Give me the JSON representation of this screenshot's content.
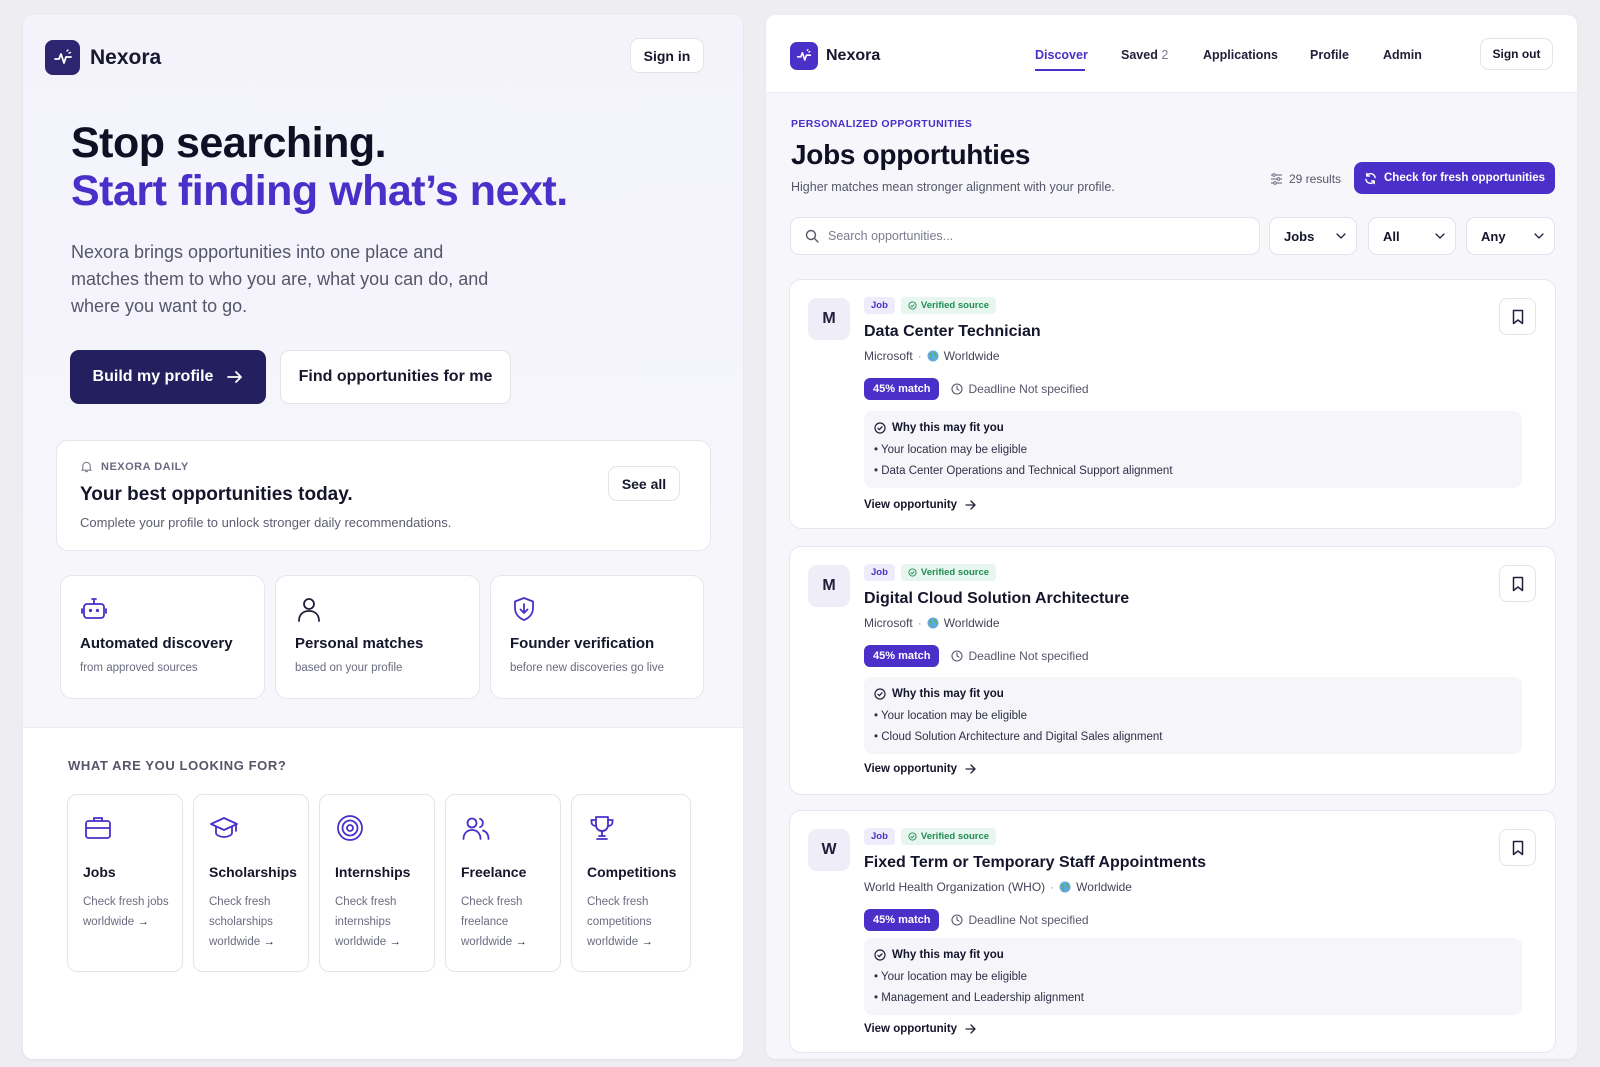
{
  "brand": {
    "name": "Nexora",
    "accent": "#4a2fc8",
    "dark": "#24205f"
  },
  "landing": {
    "sign_in": "Sign in",
    "headline_1": "Stop searching.",
    "headline_2": "Start finding what’s next.",
    "subtitle": "Nexora brings opportunities into one place and matches them to who you are, what you can do, and where you want to go.",
    "primary_cta": "Build my profile",
    "secondary_cta": "Find opportunities for me",
    "daily": {
      "label": "NEXORA DAILY",
      "title": "Your best opportunities today.",
      "subtitle": "Complete your profile to unlock stronger daily recommendations.",
      "see_all": "See all"
    },
    "features": [
      {
        "icon": "robot-icon",
        "title": "Automated discovery",
        "subtitle": "from approved sources"
      },
      {
        "icon": "user-icon",
        "title": "Personal matches",
        "subtitle": "based on your profile"
      },
      {
        "icon": "shield-icon",
        "title": "Founder verification",
        "subtitle": "before new discoveries go live"
      }
    ],
    "looking_for_label": "WHAT ARE YOU LOOKING FOR?",
    "categories": [
      {
        "icon": "briefcase-icon",
        "title": "Jobs",
        "line1": "Check fresh jobs",
        "line2": "worldwide"
      },
      {
        "icon": "graduation-cap-icon",
        "title": "Scholarships",
        "line1": "Check fresh scholarships",
        "line2": "worldwide"
      },
      {
        "icon": "target-icon",
        "title": "Internships",
        "line1": "Check fresh internships",
        "line2": "worldwide"
      },
      {
        "icon": "people-icon",
        "title": "Freelance",
        "line1": "Check fresh freelance",
        "line2": "worldwide"
      },
      {
        "icon": "trophy-icon",
        "title": "Competitions",
        "line1": "Check fresh competitions",
        "line2": "worldwide"
      }
    ]
  },
  "app": {
    "nav": {
      "discover": "Discover",
      "saved": "Saved",
      "saved_count": "2",
      "applications": "Applications",
      "profile": "Profile",
      "admin": "Admin",
      "sign_out": "Sign out"
    },
    "eyebrow": "PERSONALIZED OPPORTUNITIES",
    "title": "Jobs opportuhties",
    "subtitle": "Higher matches mean stronger alignment with your profile.",
    "results": "29 results",
    "fresh_button": "Check for fresh opportunities",
    "search_placeholder": "Search opportunities...",
    "filters": {
      "type": "Jobs",
      "scope": "All",
      "deadline": "Any"
    },
    "jobs": [
      {
        "avatar": "M",
        "type": "Job",
        "verified": "Verified source",
        "title": "Data Center Technician",
        "company": "Microsoft",
        "sep": "·",
        "location": "Worldwide",
        "match": "45% match",
        "deadline": "Deadline Not specified",
        "why_title": "Why this may fit you",
        "reasons": [
          "• Your location may be eligible",
          "• Data Center Operations and Technical Support alignment"
        ],
        "view": "View opportunity"
      },
      {
        "avatar": "M",
        "type": "Job",
        "verified": "Verified source",
        "title": "Digital Cloud Solution Architecture",
        "company": "Microsoft",
        "sep": "·",
        "location": "Worldwide",
        "match": "45% match",
        "deadline": "Deadline Not specified",
        "why_title": "Why this may fit you",
        "reasons": [
          "• Your location may be eligible",
          "• Cloud Solution Architecture and Digital Sales alignment"
        ],
        "view": "View opportunity"
      },
      {
        "avatar": "W",
        "type": "Job",
        "verified": "Verified source",
        "title": "Fixed Term or Temporary Staff Appointments",
        "company": "World Health Organization (WHO)",
        "sep": "·",
        "location": "Worldwide",
        "match": "45% match",
        "deadline": "Deadline Not specified",
        "why_title": "Why this may fit you",
        "reasons": [
          "• Your location may be eligible",
          "• Management and Leadership alignment"
        ],
        "view": "View opportunity"
      }
    ]
  }
}
